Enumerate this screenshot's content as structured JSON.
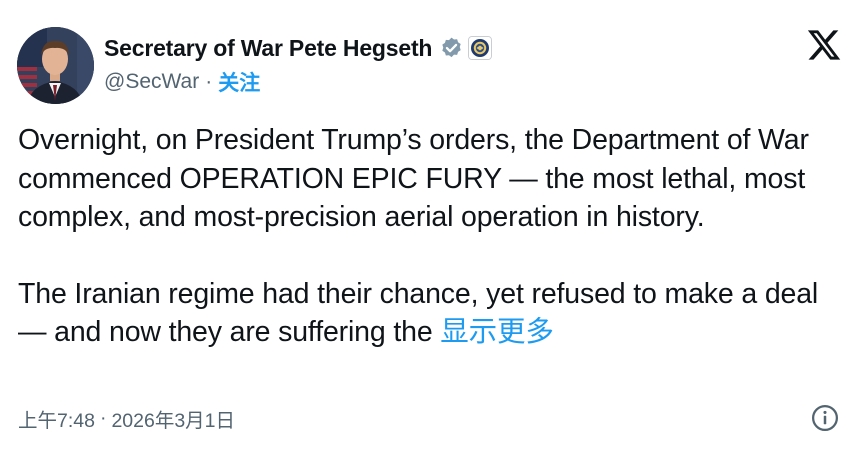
{
  "author": {
    "display_name": "Secretary of War Pete Hegseth",
    "handle": "@SecWar",
    "separator": "·",
    "follow_label": "关注"
  },
  "icons": {
    "avatar": "profile-avatar",
    "verified": "verified-badge-icon",
    "affiliate": "department-seal-icon",
    "platform_logo": "x-logo-icon",
    "info": "info-icon"
  },
  "tweet": {
    "paragraph1": "Overnight, on President Trump’s orders, the Department of War commenced OPERATION EPIC FURY — the most lethal, most complex, and most-precision aerial operation in history.",
    "paragraph2": "The Iranian regime had their chance, yet refused to make a deal — and now they are suffering the ",
    "show_more_label": "显示更多"
  },
  "meta": {
    "time": "上午7:48",
    "separator": "·",
    "date": "2026年3月1日"
  },
  "colors": {
    "text": "#0f1419",
    "secondary": "#536471",
    "link": "#1d9bf0",
    "verified": "#829aab"
  }
}
